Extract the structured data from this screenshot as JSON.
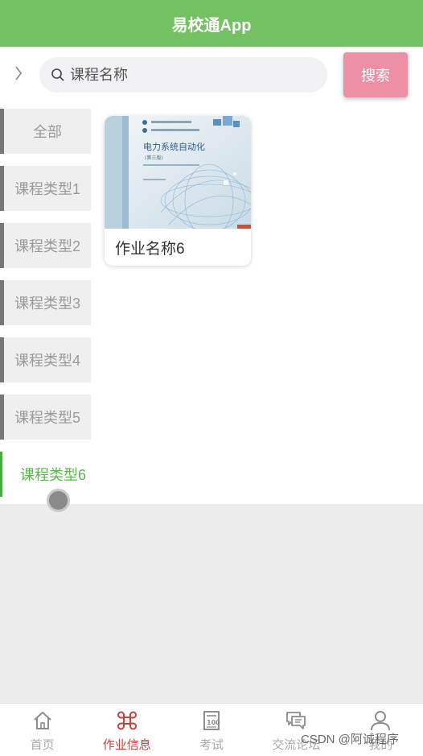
{
  "header": {
    "title": "易校通App"
  },
  "search": {
    "placeholder": "课程名称",
    "button_label": "搜索"
  },
  "sidebar": {
    "items": [
      {
        "label": "全部"
      },
      {
        "label": "课程类型1"
      },
      {
        "label": "课程类型2"
      },
      {
        "label": "课程类型3"
      },
      {
        "label": "课程类型4"
      },
      {
        "label": "课程类型5"
      },
      {
        "label": "课程类型6",
        "active": true
      }
    ]
  },
  "homework_list": [
    {
      "title": "作业名称6",
      "cover": {
        "book_title": "电力系统自动化",
        "edition": "(第三版)",
        "description": "book-cover-image"
      }
    }
  ],
  "bottom_nav": {
    "items": [
      {
        "label": "首页",
        "icon": "home-icon"
      },
      {
        "label": "作业信息",
        "icon": "command-icon",
        "active": true
      },
      {
        "label": "考试",
        "icon": "exam-paper-icon"
      },
      {
        "label": "交流论坛",
        "icon": "chat-bubbles-icon"
      },
      {
        "label": "我的",
        "icon": "user-icon"
      }
    ]
  },
  "watermark": "CSDN @阿诚程序",
  "colors": {
    "header": "#74c162",
    "search_button": "#ee8fa6",
    "active_sidebar": "#5cb44c",
    "active_nav": "#c0443a"
  }
}
